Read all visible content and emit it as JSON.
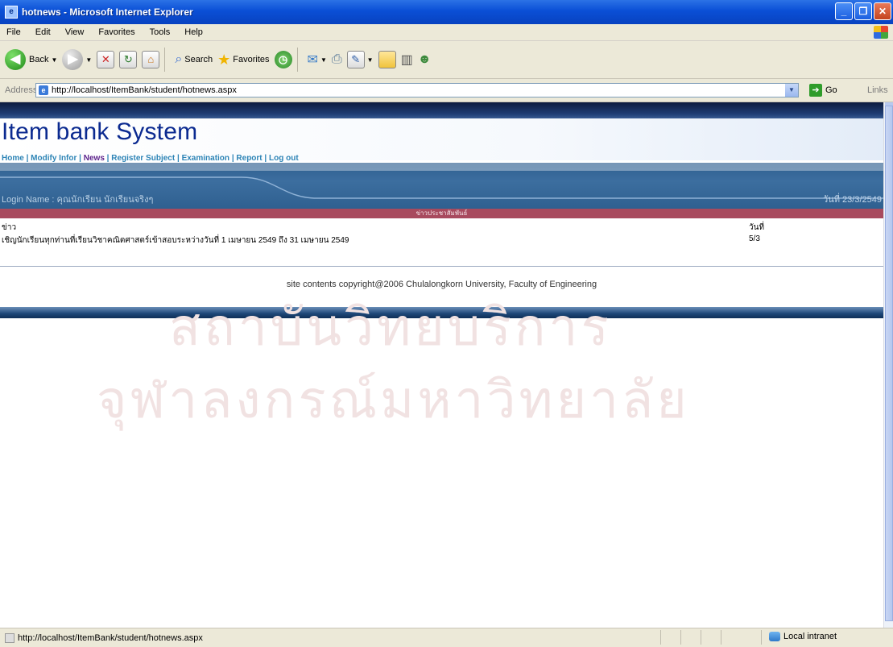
{
  "window": {
    "title": "hotnews - Microsoft Internet Explorer"
  },
  "menu": [
    "File",
    "Edit",
    "View",
    "Favorites",
    "Tools",
    "Help"
  ],
  "toolbar": {
    "back": "Back",
    "search": "Search",
    "favorites": "Favorites"
  },
  "address": {
    "label": "Address",
    "url": "http://localhost/ItemBank/student/hotnews.aspx",
    "go": "Go",
    "links": "Links"
  },
  "page": {
    "site_title": "Item bank System",
    "nav": [
      "Home",
      "Modify Infor",
      "News",
      "Register Subject",
      "Examination",
      "Report",
      "Log out"
    ],
    "nav_active": "News",
    "login_name": "Login Name : คุณนักเรียน นักเรียนจริงๆ",
    "date": "วันที่ 23/3/2549",
    "news_header": "ข่าวประชาสัมพันธ์",
    "table": {
      "headers": [
        "ข่าว",
        "วันที่"
      ],
      "rows": [
        [
          "เชิญนักเรียนทุกท่านที่เรียนวิชาคณิตศาสตร์เข้าสอบระหว่างวันที่ 1 เมษายน 2549 ถึง 31 เมษายน 2549",
          "5/3"
        ]
      ]
    },
    "copyright": "site contents copyright@2006 Chulalongkorn University, Faculty of Engineering",
    "watermark_line1": "สถาบันวิทยบริการ",
    "watermark_line2": "จุฬาลงกรณ์มหาวิทยาลัย"
  },
  "status": {
    "url": "http://localhost/ItemBank/student/hotnews.aspx",
    "zone": "Local intranet"
  }
}
